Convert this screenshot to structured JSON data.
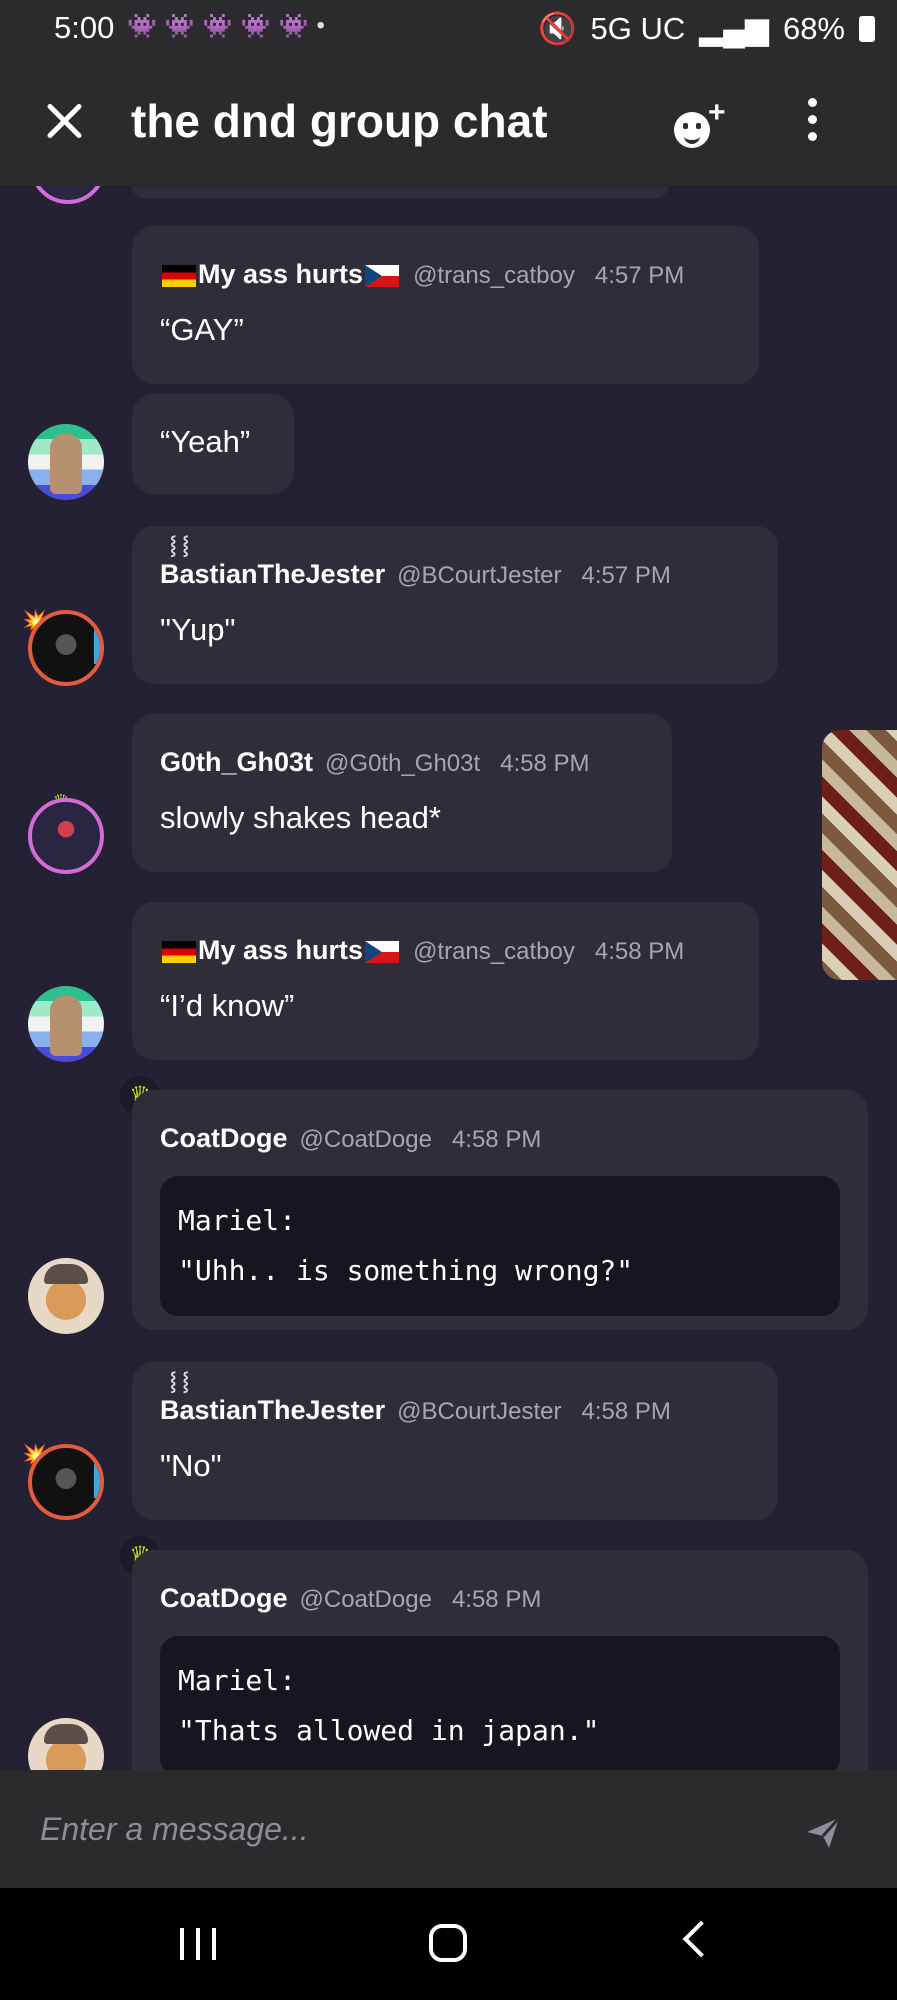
{
  "status_bar": {
    "time": "5:00",
    "notification_icons": [
      "discord-icon",
      "discord-icon",
      "discord-icon",
      "discord-icon",
      "discord-icon"
    ],
    "dot": "•",
    "network": "5G UC",
    "battery": "68%"
  },
  "header": {
    "title": "the dnd group chat"
  },
  "messages": [
    {
      "user": "My ass hurts",
      "handle": "@trans_catboy",
      "time": "4:57 PM",
      "text": "“GAY”"
    },
    {
      "text": "“Yeah”"
    },
    {
      "user": "BastianTheJester",
      "handle": "@BCourtJester",
      "time": "4:57 PM",
      "text": "\"Yup\""
    },
    {
      "user": "G0th_Gh03t",
      "handle": "@G0th_Gh03t",
      "time": "4:58 PM",
      "text": "slowly shakes head*"
    },
    {
      "user": "My ass hurts",
      "handle": "@trans_catboy",
      "time": "4:58 PM",
      "text": "“I’d know”"
    },
    {
      "user": "CoatDoge",
      "handle": "@CoatDoge",
      "time": "4:58 PM",
      "code": "Mariel:\n\"Uhh.. is something wrong?\""
    },
    {
      "user": "BastianTheJester",
      "handle": "@BCourtJester",
      "time": "4:58 PM",
      "text": "\"No\""
    },
    {
      "user": "CoatDoge",
      "handle": "@CoatDoge",
      "time": "4:58 PM",
      "code": "Mariel:\n\"Thats allowed in japan.\""
    }
  ],
  "composer": {
    "placeholder": "Enter a message..."
  },
  "colors": {
    "background": "#252134",
    "bubble": "#2f2d3a",
    "code_block": "#17151f",
    "crown": "#b6e21e"
  }
}
